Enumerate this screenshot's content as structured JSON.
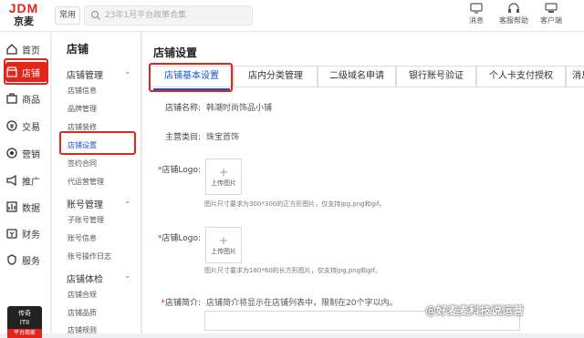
{
  "brand": {
    "logo_text": "JDM",
    "logo_sub": "京麦"
  },
  "topbar": {
    "common_label": "常用",
    "search_placeholder": "23年1月平台政策合集",
    "tools": [
      {
        "label": "消息",
        "icon": "monitor-icon"
      },
      {
        "label": "客服帮助",
        "icon": "headset-icon"
      },
      {
        "label": "客户端",
        "icon": "desktop-icon"
      }
    ]
  },
  "rail": {
    "items": [
      {
        "label": "首页",
        "icon": "home-icon"
      },
      {
        "label": "店铺",
        "icon": "store-icon"
      },
      {
        "label": "商品",
        "icon": "goods-icon"
      },
      {
        "label": "交易",
        "icon": "trade-icon"
      },
      {
        "label": "营销",
        "icon": "marketing-icon"
      },
      {
        "label": "推广",
        "icon": "promotion-icon"
      },
      {
        "label": "数据",
        "icon": "data-icon"
      },
      {
        "label": "财务",
        "icon": "finance-icon"
      },
      {
        "label": "服务",
        "icon": "service-icon"
      }
    ],
    "active_index": 1,
    "promo_text": "传奇\nITII",
    "promo_tag": "平台商家"
  },
  "side2": {
    "title": "店铺",
    "groups": [
      {
        "label": "店铺管理",
        "items": [
          "店铺信息",
          "品牌管理",
          "店铺装修",
          "店铺设置",
          "签约合同",
          "代运营管理"
        ]
      },
      {
        "label": "账号管理",
        "items": [
          "子账号管理",
          "账号信息",
          "账号操作日志"
        ]
      },
      {
        "label": "店铺体检",
        "items": [
          "店铺合规",
          "店铺品质",
          "店铺规则"
        ]
      }
    ],
    "active_item": "店铺设置"
  },
  "main": {
    "title": "店铺设置",
    "tabs": [
      "店铺基本设置",
      "店内分类管理",
      "二级域名申请",
      "银行账号验证",
      "个人卡支付授权",
      "消息"
    ],
    "active_tab": 0,
    "fields": {
      "store_name_label": "店铺名称:",
      "store_name_value": "韩潮时尚饰品小铺",
      "category_label": "主营类目:",
      "category_value": "珠宝首饰",
      "logo1_label": "店铺Logo:",
      "logo1_upload": "上传图片",
      "logo1_hint": "图片尺寸要求为300*300的正方形图片，仅支持jpg,png和gif。",
      "logo2_label": "店铺Logo:",
      "logo2_upload": "上传图片",
      "logo2_hint": "图片尺寸要求为180*60的长方形图片，仅支持jpg,png和gif。",
      "intro_label": "店铺简介:",
      "intro_hint": "店铺简介将显示在店铺列表中，限制在20个字以内。",
      "required_mark": "*"
    }
  },
  "watermark": "@好麦麦科技说运营",
  "colors": {
    "accent": "#e1251b",
    "link": "#1a4fd6"
  }
}
